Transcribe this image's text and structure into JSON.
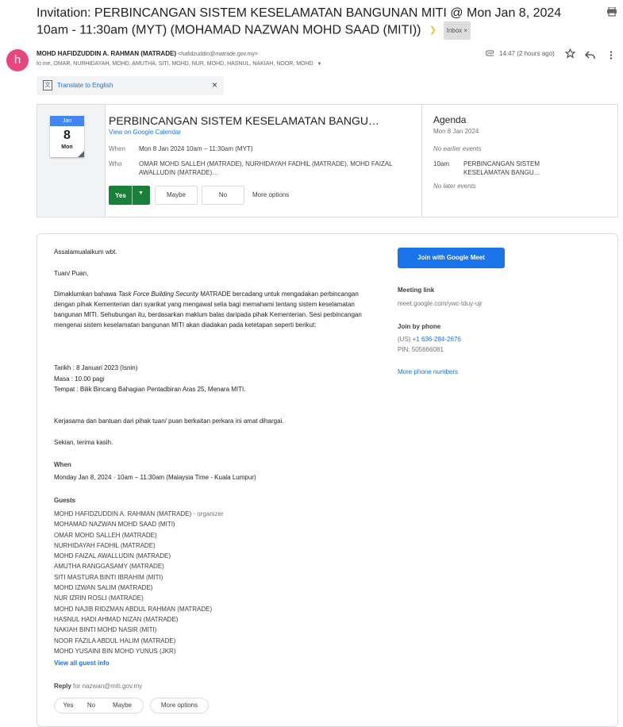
{
  "subject": "Invitation: PERBINCANGAN SISTEM KESELAMATAN BANGUNAN MITI @ Mon Jan 8, 2024 10am - 11:30am (MYT) (MOHAMAD NAZWAN MOHD SAAD (MITI))",
  "inbox_label": "Inbox",
  "inbox_remove": "×",
  "sender": {
    "avatar_letter": "h",
    "name": "MOHD HAFIDZUDDIN A. RAHMAN (MATRADE)",
    "email": "<hafidzuddin@matrade.gov.my>",
    "recipients": "to me, OMAR, NURHIDAYAH, MOHD, AMUTHA, SITI, MOHD, NUR, MOHD, HASNUL, NAKIAH, NOOR, MOHD"
  },
  "header_time": "14:47 (2 hours ago)",
  "translate": {
    "label": "Translate to English",
    "close": "×"
  },
  "invite": {
    "cal_month": "Jan",
    "cal_day": "8",
    "cal_weekday": "Mon",
    "title": "PERBINCANGAN SISTEM KESELAMATAN BANGU…",
    "view_link": "View on Google Calendar",
    "when_label": "When",
    "when_value": "Mon 8 Jan 2024 10am – 11:30am (MYT)",
    "who_label": "Who",
    "who_value": "OMAR MOHD SALLEH (MATRADE), NURHIDAYAH FADHIL (MATRADE), MOHD FAIZAL AWALLUDIN (MATRADE)…",
    "rsvp": {
      "yes": "Yes",
      "maybe": "Maybe",
      "no": "No",
      "more": "More options"
    }
  },
  "agenda": {
    "title": "Agenda",
    "date": "Mon 8 Jan 2024",
    "no_earlier": "No earlier events",
    "event_time": "10am",
    "event_title": "PERBINCANGAN SISTEM KESELAMATAN BANGU…",
    "no_later": "No later events"
  },
  "body": {
    "greeting": "Assalamualaikum wbt.",
    "salutation": "Tuan/ Puan,",
    "para_start": "Dimaklumkan bahawa ",
    "para_italic": "Task Force Building Security",
    "para_rest": " MATRADE bercadang untuk mengadakan perbincangan dengan pihak Kementerian dan syarikat yang mengawal selia bagi memahami tentang sistem keselamatan bangunan MITI. Sehubungan itu, berdasarkan maklum balas daripada pihak Kementerian. Sesi perbincangan mengenai sistem keselamatan bangunan MITI akan diadakan pada ketetapan seperti berikut:",
    "tarikh": "Tarikh : 8 Januari 2023 (Isnin)",
    "masa": "Masa : 10.00 pagi",
    "tempat": "Tempat : Bilik Bincang Bahagian Pentadbiran Aras 25, Menara MITI.",
    "kerjasama": "Kerjasama dan bantuan dari pihak tuan/ puan berkaitan perkara ini amat dihargai.",
    "closing": "Sekian, terima kasih.",
    "when_heading": "When",
    "when_value": "Monday Jan 8, 2024 · 10am – 11:30am (Malaysia Time - Kuala Lumpur)",
    "guests_heading": "Guests",
    "organizer_suffix": "- organizer",
    "guests": [
      "MOHD HAFIDZUDDIN A. RAHMAN (MATRADE)",
      "MOHAMAD NAZWAN MOHD SAAD (MITI)",
      "OMAR MOHD SALLEH (MATRADE)",
      "NURHIDAYAH FADHIL (MATRADE)",
      "MOHD FAIZAL AWALLUDIN (MATRADE)",
      "AMUTHA RANGGASAMY (MATRADE)",
      "SITI MASTURA BINTI IBRAHIM (MITI)",
      "MOHD IZWAN SALIM (MATRADE)",
      "NUR IZRIN ROSLI (MATRADE)",
      "MOHD NAJIB RIDZMAN ABDUL RAHMAN (MATRADE)",
      "HASNUL HADI AHMAD NIZAN (MATRADE)",
      "NAKIAH BINTI MOHD NASIR (MITI)",
      "NOOR FAZILA ABDUL HALIM (MATRADE)",
      "MOHD YUSAINI BIN MOHD YUNUS (JKR)"
    ],
    "view_all": "View all guest info",
    "reply_label": "Reply",
    "reply_for": "for nazwan@miti.gov.my",
    "reply_yes": "Yes",
    "reply_no": "No",
    "reply_maybe": "Maybe",
    "reply_more": "More options"
  },
  "side": {
    "meet_button": "Join with Google Meet",
    "meeting_link_label": "Meeting link",
    "meeting_link": "meet.google.com/ywc-tduy-ujr",
    "join_phone_label": "Join by phone",
    "phone_prefix": "(US) ",
    "phone_number": "+1 636-284-2676",
    "pin": "PIN: 505666081",
    "more_phone": "More phone numbers"
  },
  "colors": {
    "accent": "#1a73e8",
    "yes_green": "#188038",
    "avatar": "#e8467c"
  }
}
